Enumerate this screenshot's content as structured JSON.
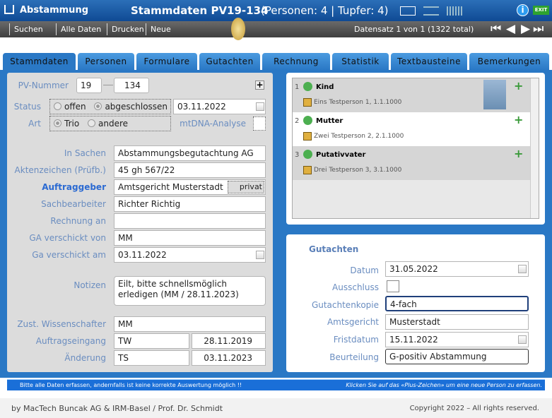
{
  "titlebar": {
    "app": "Abstammung",
    "title_main": "Stammdaten PV19-134",
    "title_sub": "(Personen: 4  |  Tupfer: 4)",
    "exit": "EXIT"
  },
  "toolbar": {
    "items": [
      "Suchen",
      "Alle Daten",
      "Drucken",
      "Neue Abstammung"
    ],
    "record": "Datensatz 1 von 1 (1322 total)"
  },
  "tabs": [
    "Stammdaten",
    "Personen",
    "Formulare",
    "Gutachten",
    "Rechnung",
    "Statistik",
    "Textbausteine",
    "Bemerkungen"
  ],
  "form": {
    "pv_label": "PV-Nummer",
    "pv_year": "19",
    "pv_num": "134",
    "status_label": "Status",
    "status_opt1": "offen",
    "status_opt2": "abgeschlossen",
    "status_date": "03.11.2022",
    "art_label": "Art",
    "art_opt1": "Trio",
    "art_opt2": "andere",
    "mtdna_label": "mtDNA-Analyse",
    "insachen_label": "In Sachen",
    "insachen": "Abstammungsbegutachtung AG",
    "az_label": "Aktenzeichen (Prüfb.)",
    "az": "45 gh 567/22",
    "auftraggeber_label": "Auftraggeber",
    "auftraggeber": "Amtsgericht Musterstadt",
    "privat": "privat",
    "sachbearbeiter_label": "Sachbearbeiter",
    "sachbearbeiter": "Richter Richtig",
    "rechnung_label": "Rechnung an",
    "rechnung": "",
    "ga_von_label": "GA verschickt von",
    "ga_von": "MM",
    "ga_am_label": "Ga verschickt am",
    "ga_am": "03.11.2022",
    "notizen_label": "Notizen",
    "notizen": "Eilt, bitte schnellsmöglich erledigen (MM / 28.11.2023)",
    "zust_label": "Zust. Wissenschafter",
    "zust": "MM",
    "eingang_label": "Auftragseingang",
    "eingang_user": "TW",
    "eingang_date": "28.11.2019",
    "aenderung_label": "Änderung",
    "aenderung_user": "TS",
    "aenderung_date": "03.11.2023"
  },
  "persons": [
    {
      "num": "1",
      "role": "Kind",
      "name": "Eins Testperson 1, 1.1.1000"
    },
    {
      "num": "2",
      "role": "Mutter",
      "name": "Zwei Testperson 2, 2.1.1000"
    },
    {
      "num": "3",
      "role": "Putativvater",
      "name": "Drei Testperson 3, 3.1.1000"
    }
  ],
  "gutachten": {
    "title": "Gutachten",
    "datum_label": "Datum",
    "datum": "31.05.2022",
    "ausschluss_label": "Ausschluss",
    "kopie_label": "Gutachtenkopie",
    "kopie": "4-fach",
    "amtsgericht_label": "Amtsgericht",
    "amtsgericht": "Musterstadt",
    "frist_label": "Fristdatum",
    "frist": "15.11.2022",
    "beurteilung_label": "Beurteilung",
    "beurteilung": "G-positiv Abstammung"
  },
  "status": {
    "left": "Bitte alle Daten erfassen, andernfalls ist keine korrekte Auswertung möglich !!",
    "right": "Klicken Sie auf das «Plus-Zeichen» um eine neue Person zu erfassen."
  },
  "footer": {
    "left": "by MacTech Buncak AG & IRM-Basel / Prof. Dr. Schmidt",
    "right": "Copyright 2022 – All rights reserved."
  }
}
